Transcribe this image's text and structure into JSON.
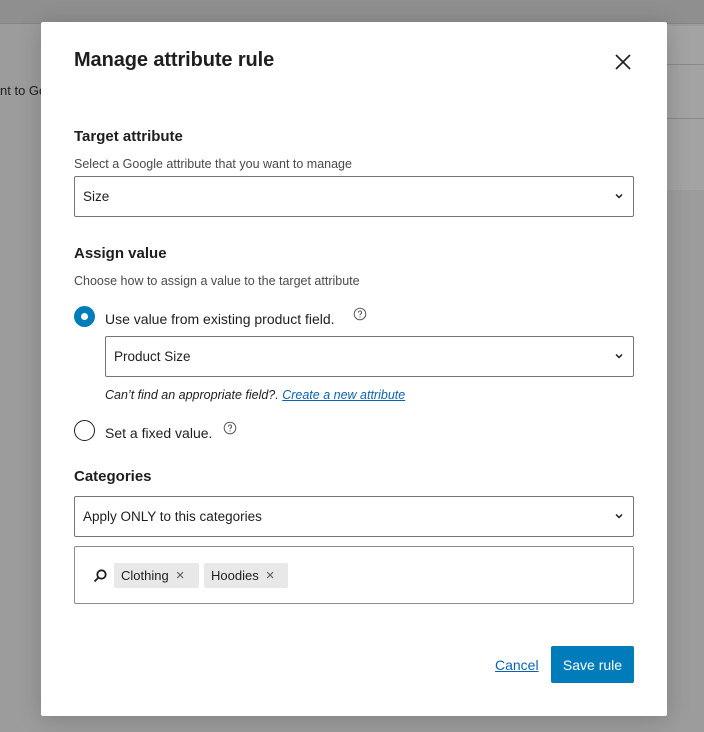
{
  "background": {
    "partial_text": "nt to Go"
  },
  "modal": {
    "title": "Manage attribute rule",
    "close_icon": "close-icon"
  },
  "target_attribute": {
    "title": "Target attribute",
    "help": "Select a Google attribute that you want to manage",
    "selected": "Size"
  },
  "assign_value": {
    "title": "Assign value",
    "help": "Choose how to assign a value to the target attribute",
    "options": [
      {
        "label": "Use value from existing product field.",
        "checked": true
      },
      {
        "label": "Set a fixed value.",
        "checked": false
      }
    ],
    "field_selected": "Product Size",
    "note_text": "Can’t find an appropriate field?.",
    "note_link": "Create a new attribute"
  },
  "categories": {
    "title": "Categories",
    "selected": "Apply ONLY to this categories",
    "tags": [
      "Clothing",
      "Hoodies"
    ],
    "remove_glyph": "×"
  },
  "footer": {
    "cancel_label": "Cancel",
    "save_label": "Save rule"
  },
  "colors": {
    "accent": "#007cba",
    "link": "#0a63b2",
    "overlay": "#9c9c9c"
  }
}
